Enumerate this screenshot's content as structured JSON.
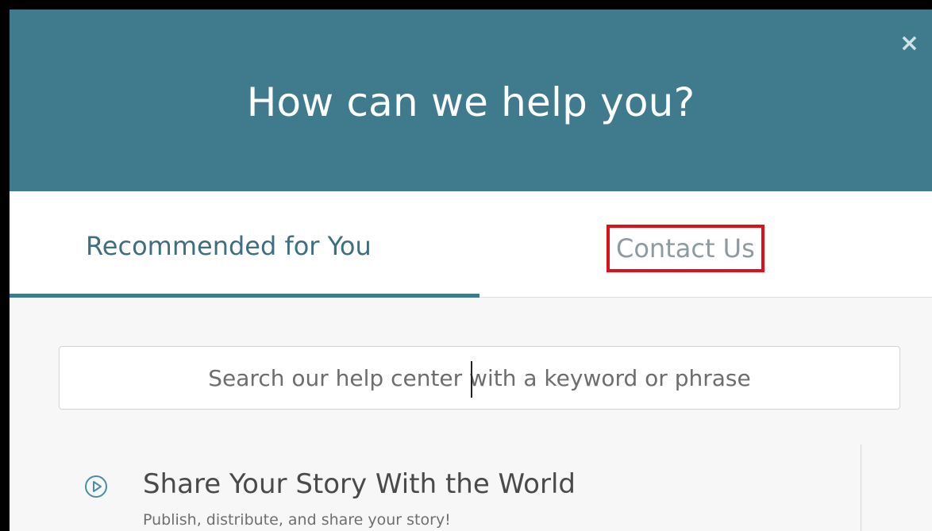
{
  "header": {
    "title": "How can we help you?",
    "close_symbol": "×"
  },
  "tabs": [
    {
      "label": "Recommended for You",
      "active": true
    },
    {
      "label": "Contact Us",
      "active": false
    }
  ],
  "search": {
    "placeholder": "Search our help center with a keyword or phrase"
  },
  "items": [
    {
      "icon": "play-circle-icon",
      "title": "Share Your Story With the World",
      "subtitle": "Publish, distribute, and share your story!"
    }
  ],
  "colors": {
    "header_bg": "#3f7a8d",
    "highlight_box": "#e0101a",
    "accent_text": "#3f6f7f"
  }
}
